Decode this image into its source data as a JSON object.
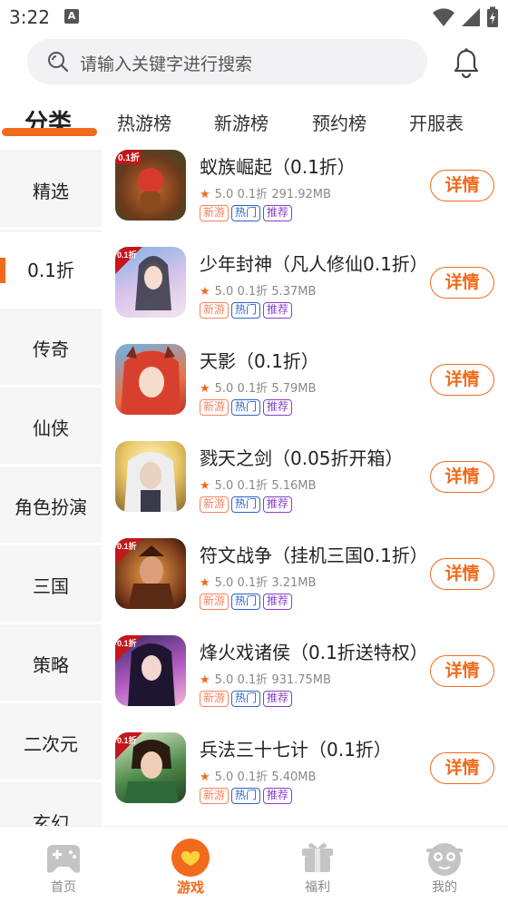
{
  "status_bar": {
    "time": "3:22"
  },
  "search": {
    "placeholder": "请输入关键字进行搜索"
  },
  "tabs": [
    {
      "label": "分类",
      "active": true
    },
    {
      "label": "热游榜"
    },
    {
      "label": "新游榜"
    },
    {
      "label": "预约榜"
    },
    {
      "label": "开服表"
    }
  ],
  "sidebar": {
    "items": [
      {
        "label": "精选"
      },
      {
        "label": "0.1折",
        "active": true
      },
      {
        "label": "传奇"
      },
      {
        "label": "仙侠"
      },
      {
        "label": "角色扮演"
      },
      {
        "label": "三国"
      },
      {
        "label": "策略"
      },
      {
        "label": "二次元"
      },
      {
        "label": "玄幻"
      }
    ]
  },
  "tag_labels": {
    "new": "新游",
    "hot": "热门",
    "rec": "推荐"
  },
  "detail_label": "详情",
  "games": [
    {
      "name": "蚁族崛起（0.1折）",
      "rating": "5.0",
      "discount": "0.1折",
      "size": "291.92MB"
    },
    {
      "name": "少年封神（凡人修仙0.1折）",
      "rating": "5.0",
      "discount": "0.1折",
      "size": "5.37MB"
    },
    {
      "name": "天影（0.1折）",
      "rating": "5.0",
      "discount": "0.1折",
      "size": "5.79MB"
    },
    {
      "name": "戮天之剑（0.05折开箱）",
      "rating": "5.0",
      "discount": "0.1折",
      "size": "5.16MB"
    },
    {
      "name": "符文战争（挂机三国0.1折）",
      "rating": "5.0",
      "discount": "0.1折",
      "size": "3.21MB"
    },
    {
      "name": "烽火戏诸侯（0.1折送特权）",
      "rating": "5.0",
      "discount": "0.1折",
      "size": "931.75MB"
    },
    {
      "name": "兵法三十七计（0.1折）",
      "rating": "5.0",
      "discount": "0.1折",
      "size": "5.40MB"
    }
  ],
  "bottom_nav": [
    {
      "label": "首页",
      "icon": "gamepad-icon"
    },
    {
      "label": "游戏",
      "icon": "heart-bubble-icon",
      "active": true
    },
    {
      "label": "福利",
      "icon": "gift-icon"
    },
    {
      "label": "我的",
      "icon": "profile-face-icon"
    }
  ],
  "colors": {
    "accent": "#f26a1b",
    "tag_new": "#f4845f",
    "tag_hot": "#2f63c8",
    "tag_rec": "#8a3fc6"
  }
}
